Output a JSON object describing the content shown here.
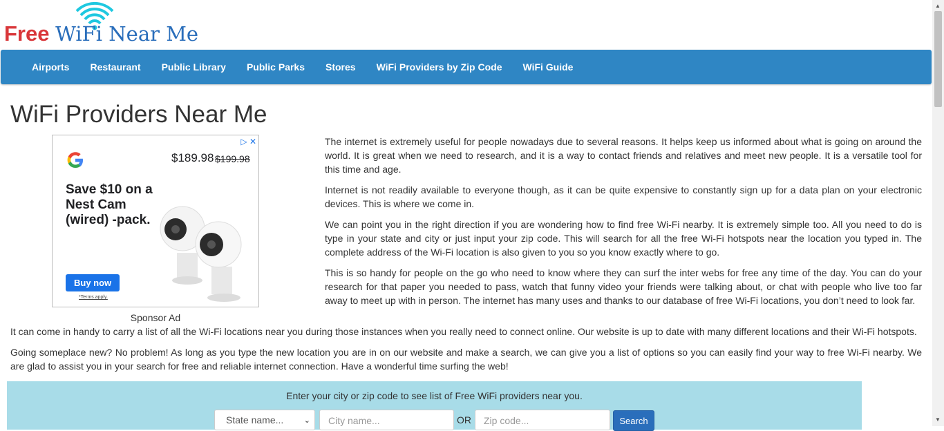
{
  "logo": {
    "free": "Free",
    "rest": "WiFi Near Me"
  },
  "nav": {
    "items": [
      "Airports",
      "Restaurant",
      "Public Library",
      "Public Parks",
      "Stores",
      "WiFi Providers by Zip Code",
      "WiFi Guide"
    ]
  },
  "page": {
    "title": "WiFi Providers Near Me"
  },
  "ad": {
    "price": "$189.98",
    "old_price": "$199.98",
    "headline": "Save $10 on a Nest Cam (wired) -pack.",
    "button": "Buy now",
    "terms": "*Terms apply.",
    "sponsor_label": "Sponsor Ad"
  },
  "content": {
    "p1": "The internet is extremely useful for people nowadays due to several reasons. It helps keep us informed about what is going on around the world. It is great when we need to research, and it is a way to contact friends and relatives and meet new people. It is a versatile tool for this time and age.",
    "p2": "Internet is not readily available to everyone though, as it can be quite expensive to constantly sign up for a data plan on your electronic devices. This is where we come in.",
    "p3": "We can point you in the right direction if you are wondering how to find free Wi-Fi nearby. It is extremely simple too. All you need to do is type in your state and city or just input your zip code. This will search for all the free Wi-Fi hotspots near the location you typed in. The complete address of the Wi-Fi location is also given to you so you know exactly where to go.",
    "p4": "This is so handy for people on the go who need to know where they can surf the inter webs for free any time of the day. You can do your research for that paper you needed to pass, watch that funny video your friends were talking about, or chat with people who live too far away to meet up with in person. The internet has many uses and thanks to our database of free Wi-Fi locations, you don’t need to look far.",
    "p5": "It can come in handy to carry a list of all the Wi-Fi locations near you during those instances when you really need to connect online. Our website is up to date with many different locations and their Wi-Fi hotspots.",
    "p6": "Going someplace new? No problem! As long as you type the new location you are in on our website and make a search, we can give you a list of options so you can easily find your way to free Wi-Fi nearby. We are glad to assist you in your search for free and reliable internet connection. Have a wonderful time surfing the web!"
  },
  "search": {
    "label": "Enter your city or zip code to see list of Free WiFi providers near you.",
    "state_placeholder": "State name...",
    "city_placeholder": "City name...",
    "or_label": "OR",
    "zip_placeholder": "Zip code...",
    "button": "Search"
  },
  "colors": {
    "nav_bg": "#2f86c4",
    "search_bg": "#a8dce8",
    "logo_red": "#d9373a",
    "logo_blue": "#2a6ebb",
    "wifi_icon": "#1ec8e0"
  }
}
